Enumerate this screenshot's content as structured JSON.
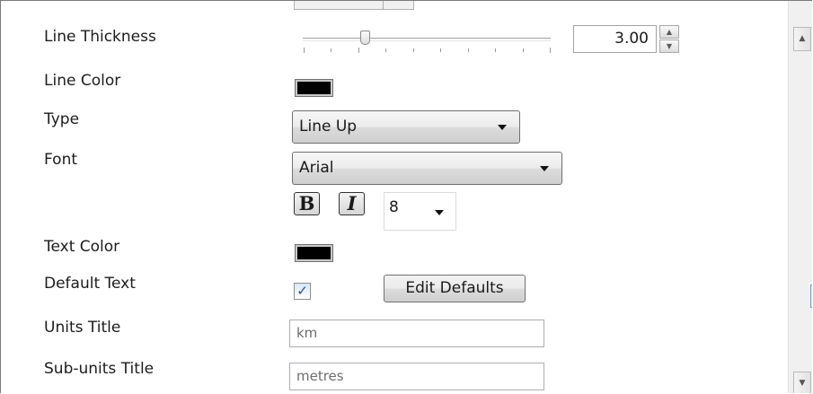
{
  "rows": {
    "line_thickness": {
      "label": "Line Thickness",
      "slider_value": 0.25,
      "value": "3.00"
    },
    "line_color": {
      "label": "Line Color",
      "color": "#000000"
    },
    "type": {
      "label": "Type",
      "selected": "Line Up"
    },
    "font": {
      "label": "Font",
      "selected": "Arial",
      "bold": "B",
      "italic": "I",
      "size": "8"
    },
    "text_color": {
      "label": "Text Color",
      "color": "#000000"
    },
    "default_text": {
      "label": "Default Text",
      "checked": true,
      "check_glyph": "✓",
      "button": "Edit Defaults"
    },
    "units_title": {
      "label": "Units Title",
      "value": "km"
    },
    "subunits_title": {
      "label": "Sub-units Title",
      "value": "metres"
    }
  },
  "icons": {
    "spin_up": "up-arrow-icon",
    "spin_down": "down-arrow-icon",
    "scroll_up": "scroll-up-icon",
    "scroll_down": "scroll-down-icon",
    "dropdown": "chevron-down-icon"
  }
}
